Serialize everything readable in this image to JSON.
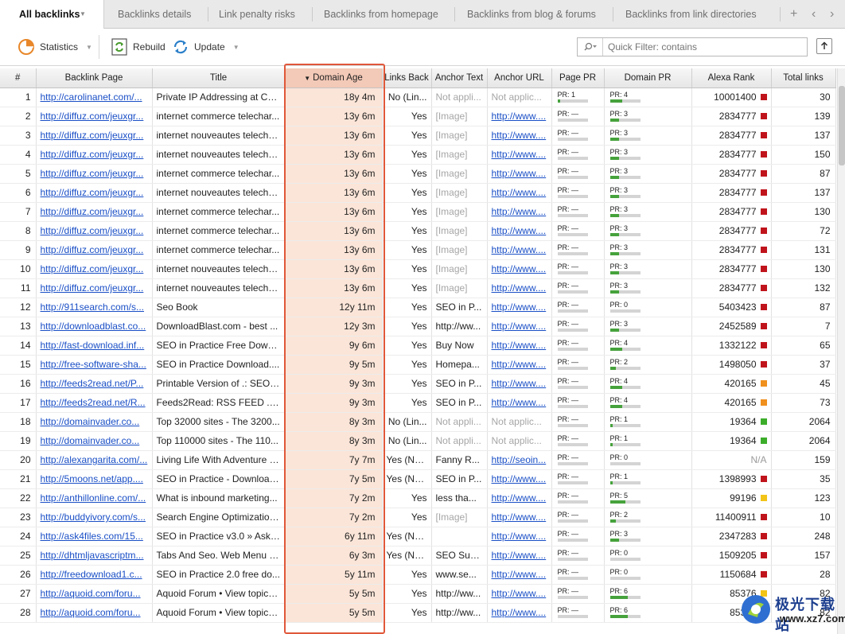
{
  "tabs": [
    {
      "label": "All backlinks"
    },
    {
      "label": "Backlinks details"
    },
    {
      "label": "Link penalty risks"
    },
    {
      "label": "Backlinks from homepage"
    },
    {
      "label": "Backlinks from blog & forums"
    },
    {
      "label": "Backlinks from link directories"
    }
  ],
  "toolbar": {
    "statistics_label": "Statistics",
    "rebuild_label": "Rebuild",
    "update_label": "Update",
    "filter_placeholder": "Quick Filter: contains"
  },
  "columns": [
    "#",
    "Backlink Page",
    "Title",
    "Domain Age",
    "Links Back",
    "Anchor Text",
    "Anchor URL",
    "Page PR",
    "Domain PR",
    "Alexa Rank",
    "Total links"
  ],
  "sorted_column": "Domain Age",
  "colors": {
    "alexa_red": "#c0141c",
    "alexa_orange": "#f0901e",
    "alexa_green": "#3cad2a",
    "alexa_yellow": "#f2c418",
    "highlight": "#e0583a",
    "pr_bar": "#46a23c"
  },
  "rows": [
    {
      "n": "1",
      "page": "http://carolinanet.com/...",
      "title": "Private IP Addressing at CA...",
      "age": "18y 4m",
      "back": "No (Lin...",
      "anchor": "Not appli...",
      "url": "Not applic...",
      "ppr": "PR: 1",
      "pprv": 1,
      "dpr": "PR: 4",
      "dprv": 4,
      "alexa": "10001400",
      "ac": "red",
      "total": "30"
    },
    {
      "n": "2",
      "page": "http://diffuz.com/jeuxgr...",
      "title": "internet commerce telechar...",
      "age": "13y 6m",
      "back": "Yes",
      "anchor": "[Image]",
      "url": "http://www....",
      "ppr": "PR: —",
      "pprv": 0,
      "dpr": "PR: 3",
      "dprv": 3,
      "alexa": "2834777",
      "ac": "red",
      "total": "139"
    },
    {
      "n": "3",
      "page": "http://diffuz.com/jeuxgr...",
      "title": "internet nouveautes telecha...",
      "age": "13y 6m",
      "back": "Yes",
      "anchor": "[Image]",
      "url": "http://www....",
      "ppr": "PR: —",
      "pprv": 0,
      "dpr": "PR: 3",
      "dprv": 3,
      "alexa": "2834777",
      "ac": "red",
      "total": "137"
    },
    {
      "n": "4",
      "page": "http://diffuz.com/jeuxgr...",
      "title": "internet nouveautes telecha...",
      "age": "13y 6m",
      "back": "Yes",
      "anchor": "[Image]",
      "url": "http://www....",
      "ppr": "PR: —",
      "pprv": 0,
      "dpr": "PR: 3",
      "dprv": 3,
      "alexa": "2834777",
      "ac": "red",
      "total": "150"
    },
    {
      "n": "5",
      "page": "http://diffuz.com/jeuxgr...",
      "title": "internet commerce telechar...",
      "age": "13y 6m",
      "back": "Yes",
      "anchor": "[Image]",
      "url": "http://www....",
      "ppr": "PR: —",
      "pprv": 0,
      "dpr": "PR: 3",
      "dprv": 3,
      "alexa": "2834777",
      "ac": "red",
      "total": "87"
    },
    {
      "n": "6",
      "page": "http://diffuz.com/jeuxgr...",
      "title": "internet nouveautes telecha...",
      "age": "13y 6m",
      "back": "Yes",
      "anchor": "[Image]",
      "url": "http://www....",
      "ppr": "PR: —",
      "pprv": 0,
      "dpr": "PR: 3",
      "dprv": 3,
      "alexa": "2834777",
      "ac": "red",
      "total": "137"
    },
    {
      "n": "7",
      "page": "http://diffuz.com/jeuxgr...",
      "title": "internet commerce telechar...",
      "age": "13y 6m",
      "back": "Yes",
      "anchor": "[Image]",
      "url": "http://www....",
      "ppr": "PR: —",
      "pprv": 0,
      "dpr": "PR: 3",
      "dprv": 3,
      "alexa": "2834777",
      "ac": "red",
      "total": "130"
    },
    {
      "n": "8",
      "page": "http://diffuz.com/jeuxgr...",
      "title": "internet commerce telechar...",
      "age": "13y 6m",
      "back": "Yes",
      "anchor": "[Image]",
      "url": "http://www....",
      "ppr": "PR: —",
      "pprv": 0,
      "dpr": "PR: 3",
      "dprv": 3,
      "alexa": "2834777",
      "ac": "red",
      "total": "72"
    },
    {
      "n": "9",
      "page": "http://diffuz.com/jeuxgr...",
      "title": "internet commerce telechar...",
      "age": "13y 6m",
      "back": "Yes",
      "anchor": "[Image]",
      "url": "http://www....",
      "ppr": "PR: —",
      "pprv": 0,
      "dpr": "PR: 3",
      "dprv": 3,
      "alexa": "2834777",
      "ac": "red",
      "total": "131"
    },
    {
      "n": "10",
      "page": "http://diffuz.com/jeuxgr...",
      "title": "internet nouveautes telecha...",
      "age": "13y 6m",
      "back": "Yes",
      "anchor": "[Image]",
      "url": "http://www....",
      "ppr": "PR: —",
      "pprv": 0,
      "dpr": "PR: 3",
      "dprv": 3,
      "alexa": "2834777",
      "ac": "red",
      "total": "130"
    },
    {
      "n": "11",
      "page": "http://diffuz.com/jeuxgr...",
      "title": "internet nouveautes telecha...",
      "age": "13y 6m",
      "back": "Yes",
      "anchor": "[Image]",
      "url": "http://www....",
      "ppr": "PR: —",
      "pprv": 0,
      "dpr": "PR: 3",
      "dprv": 3,
      "alexa": "2834777",
      "ac": "red",
      "total": "132"
    },
    {
      "n": "12",
      "page": "http://911search.com/s...",
      "title": "Seo Book",
      "age": "12y 11m",
      "back": "Yes",
      "anchor": "SEO in P...",
      "url": "http://www....",
      "ppr": "PR: —",
      "pprv": 0,
      "dpr": "PR: 0",
      "dprv": 0,
      "alexa": "5403423",
      "ac": "red",
      "total": "87"
    },
    {
      "n": "13",
      "page": "http://downloadblast.co...",
      "title": "DownloadBlast.com - best ...",
      "age": "12y 3m",
      "back": "Yes",
      "anchor": "http://ww...",
      "url": "http://www....",
      "ppr": "PR: —",
      "pprv": 0,
      "dpr": "PR: 3",
      "dprv": 3,
      "alexa": "2452589",
      "ac": "red",
      "total": "7"
    },
    {
      "n": "14",
      "page": "http://fast-download.inf...",
      "title": "SEO in Practice Free Downl...",
      "age": "9y 6m",
      "back": "Yes",
      "anchor": "Buy Now",
      "url": "http://www....",
      "ppr": "PR: —",
      "pprv": 0,
      "dpr": "PR: 4",
      "dprv": 4,
      "alexa": "1332122",
      "ac": "red",
      "total": "65"
    },
    {
      "n": "15",
      "page": "http://free-software-sha...",
      "title": "SEO in Practice Download....",
      "age": "9y 5m",
      "back": "Yes",
      "anchor": "Homepa...",
      "url": "http://www....",
      "ppr": "PR: —",
      "pprv": 0,
      "dpr": "PR: 2",
      "dprv": 2,
      "alexa": "1498050",
      "ac": "red",
      "total": "37"
    },
    {
      "n": "16",
      "page": "http://feeds2read.net/P...",
      "title": "Printable Version of .: SEO ...",
      "age": "9y 3m",
      "back": "Yes",
      "anchor": "SEO in P...",
      "url": "http://www....",
      "ppr": "PR: —",
      "pprv": 0,
      "dpr": "PR: 4",
      "dprv": 4,
      "alexa": "420165",
      "ac": "orange",
      "total": "45"
    },
    {
      "n": "17",
      "page": "http://feeds2read.net/R...",
      "title": "Feeds2Read: RSS FEED .: ...",
      "age": "9y 3m",
      "back": "Yes",
      "anchor": "SEO in P...",
      "url": "http://www....",
      "ppr": "PR: —",
      "pprv": 0,
      "dpr": "PR: 4",
      "dprv": 4,
      "alexa": "420165",
      "ac": "orange",
      "total": "73"
    },
    {
      "n": "18",
      "page": "http://domainvader.co...",
      "title": "Top 32000 sites - The 3200...",
      "age": "8y 3m",
      "back": "No (Lin...",
      "anchor": "Not appli...",
      "url": "Not applic...",
      "ppr": "PR: —",
      "pprv": 0,
      "dpr": "PR: 1",
      "dprv": 1,
      "alexa": "19364",
      "ac": "green",
      "total": "2064"
    },
    {
      "n": "19",
      "page": "http://domainvader.co...",
      "title": "Top 110000 sites - The 110...",
      "age": "8y 3m",
      "back": "No (Lin...",
      "anchor": "Not appli...",
      "url": "Not applic...",
      "ppr": "PR: —",
      "pprv": 0,
      "dpr": "PR: 1",
      "dprv": 1,
      "alexa": "19364",
      "ac": "green",
      "total": "2064"
    },
    {
      "n": "20",
      "page": "http://alexangarita.com/...",
      "title": "Living Life With Adventure & ...",
      "age": "7y 7m",
      "back": "Yes (No...",
      "anchor": "Fanny R...",
      "url": "http://seoin...",
      "ppr": "PR: —",
      "pprv": 0,
      "dpr": "PR: 0",
      "dprv": 0,
      "alexa": "N/A",
      "ac": "",
      "total": "159"
    },
    {
      "n": "21",
      "page": "http://5moons.net/app....",
      "title": "SEO in Practice - Download...",
      "age": "7y 5m",
      "back": "Yes (No...",
      "anchor": "SEO in P...",
      "url": "http://www....",
      "ppr": "PR: —",
      "pprv": 0,
      "dpr": "PR: 1",
      "dprv": 1,
      "alexa": "1398993",
      "ac": "red",
      "total": "35"
    },
    {
      "n": "22",
      "page": "http://anthillonline.com/...",
      "title": "What is inbound marketing...",
      "age": "7y 2m",
      "back": "Yes",
      "anchor": "less tha...",
      "url": "http://www....",
      "ppr": "PR: —",
      "pprv": 0,
      "dpr": "PR: 5",
      "dprv": 5,
      "alexa": "99196",
      "ac": "yellow",
      "total": "123"
    },
    {
      "n": "23",
      "page": "http://buddyivory.com/s...",
      "title": "Search Engine Optimization...",
      "age": "7y 2m",
      "back": "Yes",
      "anchor": "[Image]",
      "url": "http://www....",
      "ppr": "PR: —",
      "pprv": 0,
      "dpr": "PR: 2",
      "dprv": 2,
      "alexa": "11400911",
      "ac": "red",
      "total": "10"
    },
    {
      "n": "24",
      "page": "http://ask4files.com/15...",
      "title": "SEO in Practice v3.0 » Ask f...",
      "age": "6y 11m",
      "back": "Yes (No...",
      "anchor": "",
      "url": "http://www....",
      "ppr": "PR: —",
      "pprv": 0,
      "dpr": "PR: 3",
      "dprv": 3,
      "alexa": "2347283",
      "ac": "red",
      "total": "248"
    },
    {
      "n": "25",
      "page": "http://dhtmljavascriptm...",
      "title": "Tabs And Seo. Web Menu H...",
      "age": "6y 3m",
      "back": "Yes (No...",
      "anchor": "SEO Suc...",
      "url": "http://www....",
      "ppr": "PR: —",
      "pprv": 0,
      "dpr": "PR: 0",
      "dprv": 0,
      "alexa": "1509205",
      "ac": "red",
      "total": "157"
    },
    {
      "n": "26",
      "page": "http://freedownload1.c...",
      "title": "SEO in Practice 2.0 free do...",
      "age": "5y 11m",
      "back": "Yes",
      "anchor": "www.se...",
      "url": "http://www....",
      "ppr": "PR: —",
      "pprv": 0,
      "dpr": "PR: 0",
      "dprv": 0,
      "alexa": "1150684",
      "ac": "red",
      "total": "28"
    },
    {
      "n": "27",
      "page": "http://aquoid.com/foru...",
      "title": "Aquoid Forum • View topic -...",
      "age": "5y 5m",
      "back": "Yes",
      "anchor": "http://ww...",
      "url": "http://www....",
      "ppr": "PR: —",
      "pprv": 0,
      "dpr": "PR: 6",
      "dprv": 6,
      "alexa": "85376",
      "ac": "yellow",
      "total": "82"
    },
    {
      "n": "28",
      "page": "http://aquoid.com/foru...",
      "title": "Aquoid Forum • View topic -...",
      "age": "5y 5m",
      "back": "Yes",
      "anchor": "http://ww...",
      "url": "http://www....",
      "ppr": "PR: —",
      "pprv": 0,
      "dpr": "PR: 6",
      "dprv": 6,
      "alexa": "85376",
      "ac": "yellow",
      "total": "82"
    }
  ],
  "watermark": {
    "title": "极光下载站",
    "site": "www.xz7.com"
  }
}
